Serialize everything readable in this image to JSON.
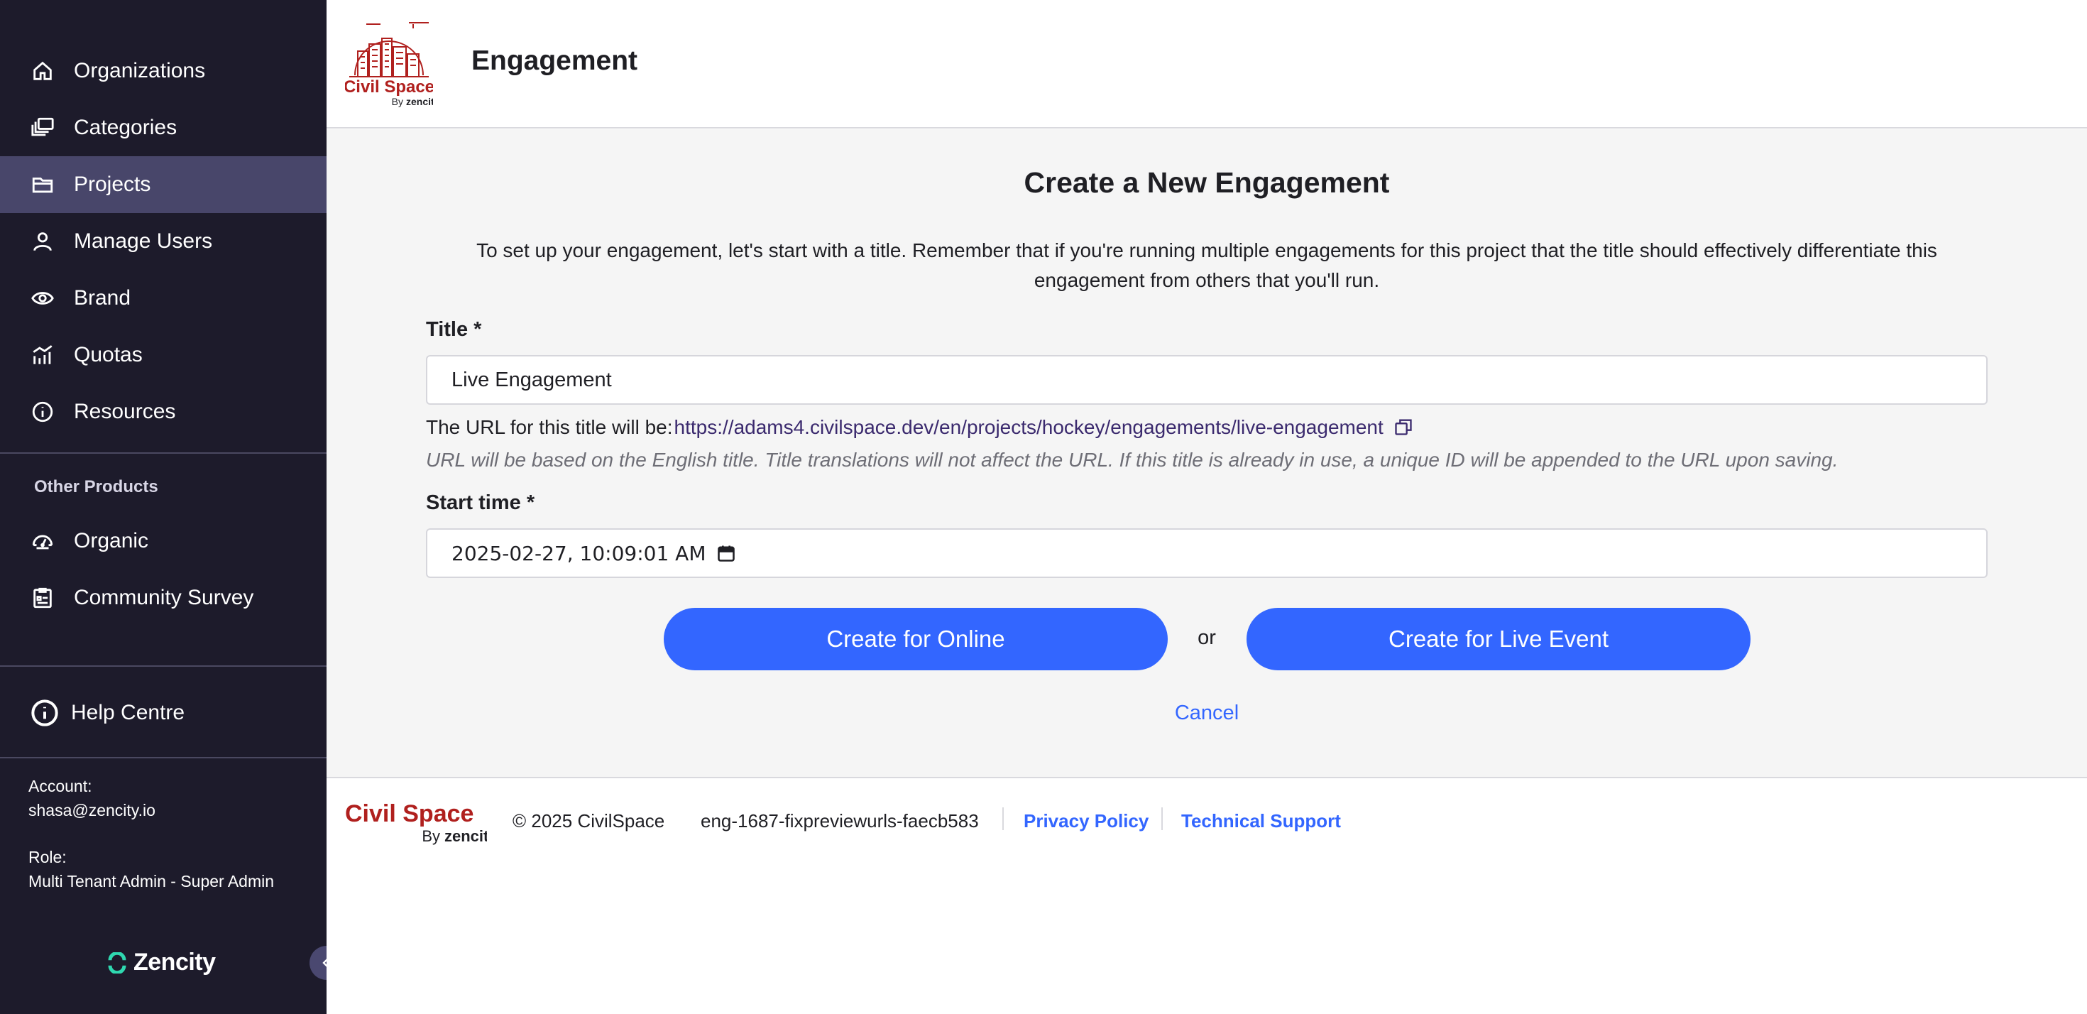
{
  "sidebar": {
    "items": [
      {
        "label": "Organizations",
        "icon": "home-icon"
      },
      {
        "label": "Categories",
        "icon": "categories-icon"
      },
      {
        "label": "Projects",
        "icon": "folder-icon",
        "active": true
      },
      {
        "label": "Manage Users",
        "icon": "user-icon"
      },
      {
        "label": "Brand",
        "icon": "eye-icon"
      },
      {
        "label": "Quotas",
        "icon": "chart-icon"
      },
      {
        "label": "Resources",
        "icon": "info-icon"
      }
    ],
    "other_products_title": "Other Products",
    "other_products": [
      {
        "label": "Organic",
        "icon": "gauge-icon"
      },
      {
        "label": "Community Survey",
        "icon": "survey-icon"
      }
    ],
    "help_label": "Help Centre",
    "account_label": "Account:",
    "account_value": "shasa@zencity.io",
    "role_label": "Role:",
    "role_value": "Multi Tenant Admin - Super Admin",
    "brand": "Zencity"
  },
  "header": {
    "title": "Engagement",
    "logo_text": "Civil Space",
    "logo_sub_by": "By",
    "logo_sub_brand": "zencity"
  },
  "form": {
    "title": "Create a New Engagement",
    "intro": "To set up your engagement, let's start with a title. Remember that if you're running multiple engagements for this project that the title should effectively differentiate this engagement from others that you'll run.",
    "title_label": "Title *",
    "title_value": "Live Engagement",
    "url_prefix": "The URL for this title will be:",
    "url": "https://adams4.civilspace.dev/en/projects/hockey/engagements/live-engagement",
    "url_note": "URL will be based on the English title. Title translations will not affect the URL. If this title is already in use, a unique ID will be appended to the URL upon saving.",
    "start_label": "Start time *",
    "start_value": "2025-02-27, 10:09:01 AM",
    "create_online": "Create for Online",
    "or": "or",
    "create_live": "Create for Live Event",
    "cancel": "Cancel"
  },
  "footer": {
    "copyright": "© 2025 CivilSpace",
    "build": "eng-1687-fixpreviewurls-faecb583",
    "privacy": "Privacy Policy",
    "support": "Technical Support"
  },
  "colors": {
    "sidebar_bg": "#1d1b2b",
    "sidebar_active": "#48466a",
    "primary": "#3366ff",
    "logo_red": "#b0201e",
    "url_color": "#3b2a6e"
  }
}
